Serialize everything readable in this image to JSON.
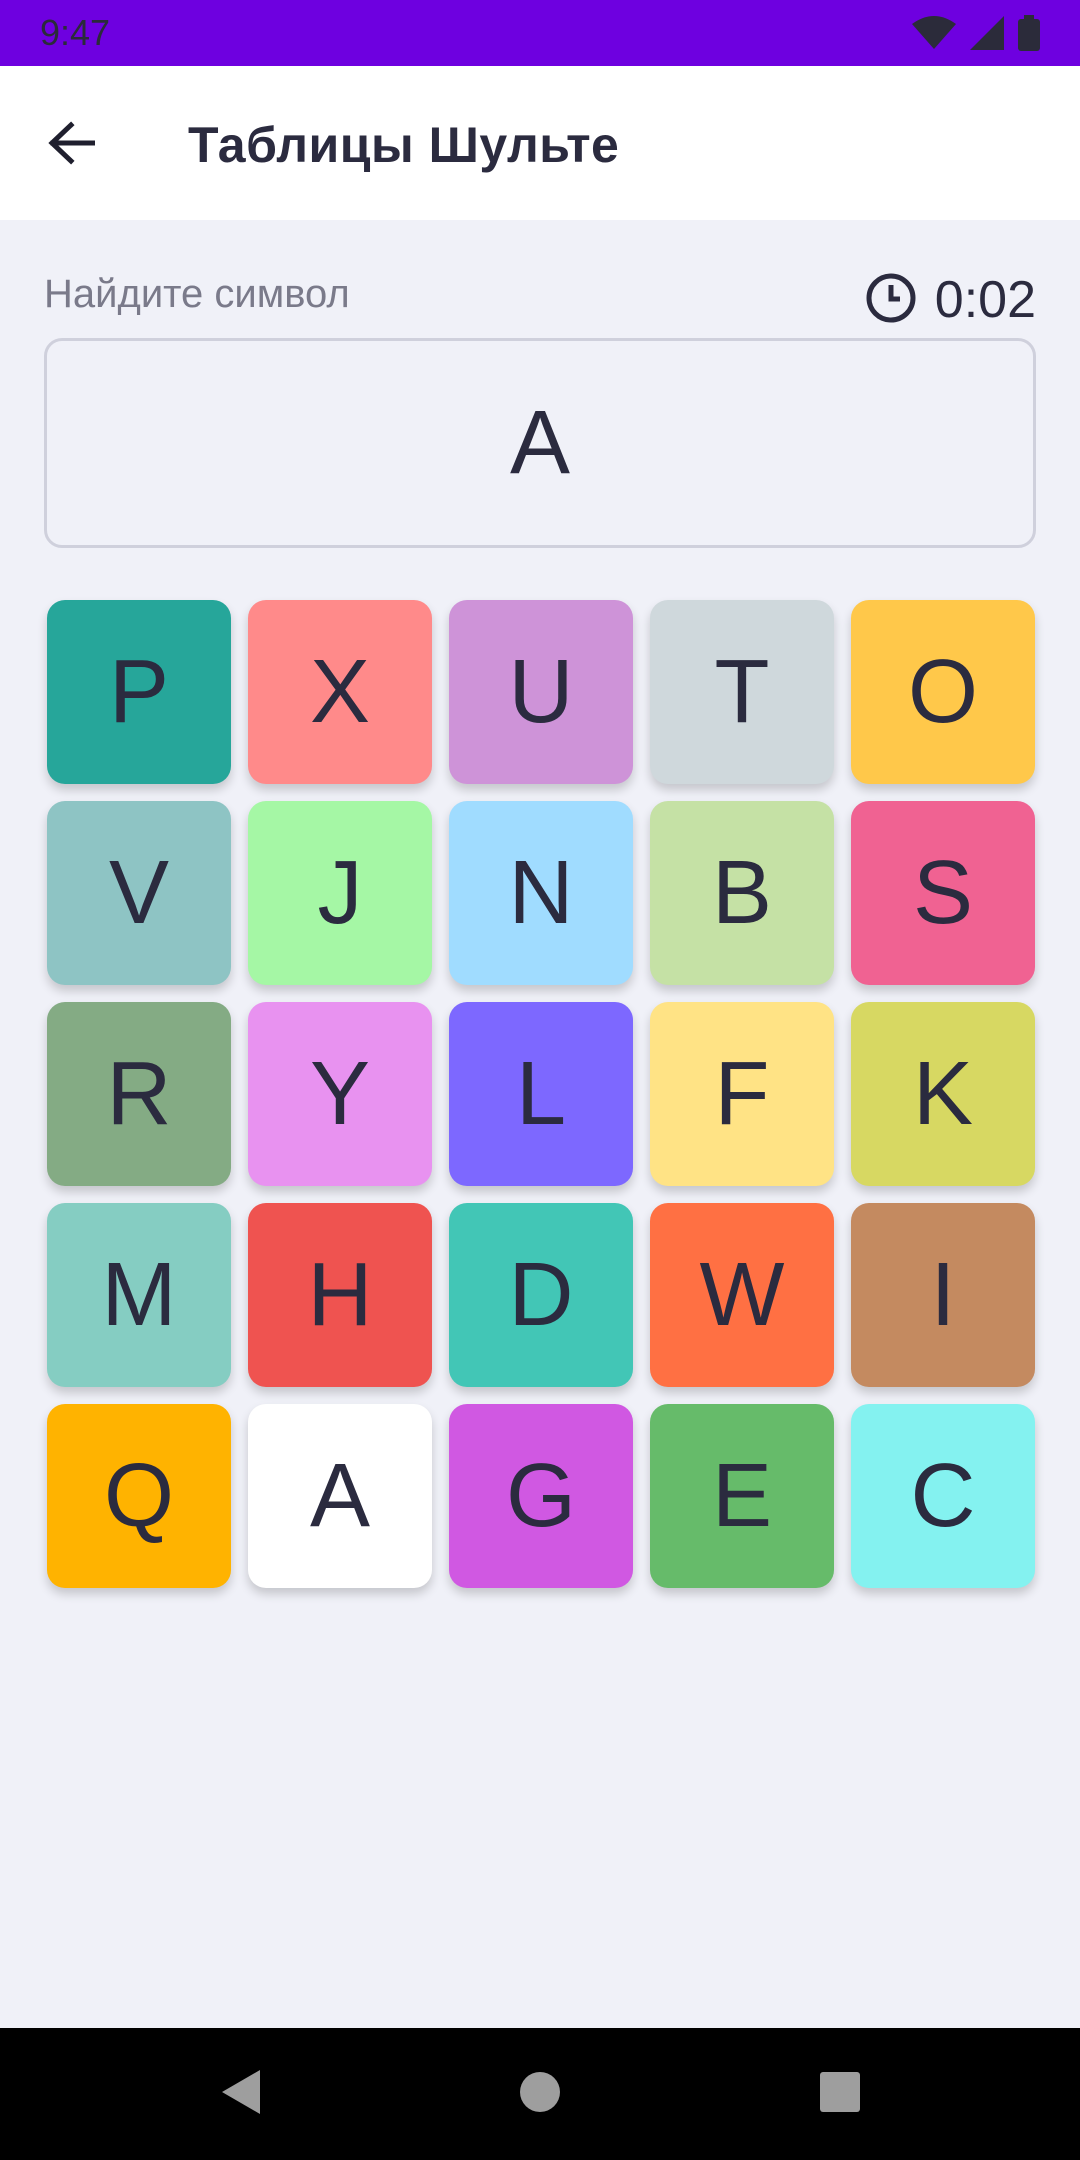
{
  "status_bar": {
    "time": "9:47",
    "color": "#6e00e0"
  },
  "app_bar": {
    "title": "Таблицы Шульте"
  },
  "game": {
    "find_label": "Найдите символ",
    "timer": "0:02",
    "target": "A",
    "grid": [
      {
        "letter": "P",
        "color": "#26a69a"
      },
      {
        "letter": "X",
        "color": "#ff8a8a"
      },
      {
        "letter": "U",
        "color": "#ce93d8"
      },
      {
        "letter": "T",
        "color": "#cfd8dc"
      },
      {
        "letter": "O",
        "color": "#ffc84a"
      },
      {
        "letter": "V",
        "color": "#8ec4c4"
      },
      {
        "letter": "J",
        "color": "#a5f7a5"
      },
      {
        "letter": "N",
        "color": "#a0dcff"
      },
      {
        "letter": "B",
        "color": "#c5e1a5"
      },
      {
        "letter": "S",
        "color": "#f06292"
      },
      {
        "letter": "R",
        "color": "#84ab84"
      },
      {
        "letter": "Y",
        "color": "#e892f0"
      },
      {
        "letter": "L",
        "color": "#7d68ff"
      },
      {
        "letter": "F",
        "color": "#ffe385"
      },
      {
        "letter": "K",
        "color": "#d7d862"
      },
      {
        "letter": "M",
        "color": "#85cdc2"
      },
      {
        "letter": "H",
        "color": "#ef5350"
      },
      {
        "letter": "D",
        "color": "#42c6b6"
      },
      {
        "letter": "W",
        "color": "#ff7043"
      },
      {
        "letter": "I",
        "color": "#c48a60"
      },
      {
        "letter": "Q",
        "color": "#ffb300"
      },
      {
        "letter": "A",
        "color": "#ffffff"
      },
      {
        "letter": "G",
        "color": "#d058e2"
      },
      {
        "letter": "E",
        "color": "#66bb6a"
      },
      {
        "letter": "C",
        "color": "#84f2f0"
      }
    ]
  },
  "icons": {
    "back": "arrow-left-icon",
    "timer": "clock-icon",
    "wifi": "wifi-icon",
    "signal": "signal-icon",
    "battery": "battery-icon",
    "nav_back": "triangle-back-icon",
    "nav_home": "circle-home-icon",
    "nav_recents": "square-recents-icon"
  }
}
